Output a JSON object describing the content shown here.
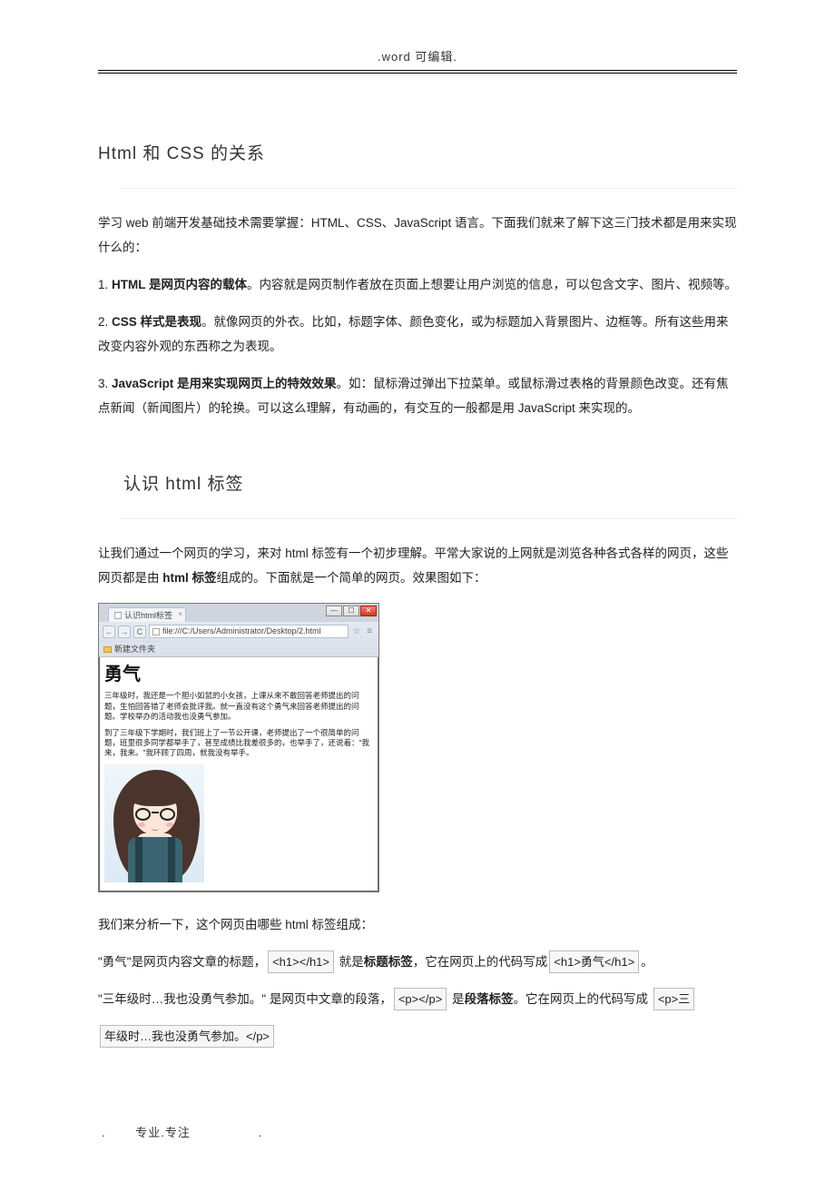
{
  "header": {
    "text": ".word 可编辑."
  },
  "footer": {
    "left_dot": ".",
    "center": "专业.专注",
    "right_dot": "."
  },
  "sections": {
    "s1": {
      "title": "Html 和 CSS 的关系",
      "p1_a": "学习 web 前端开发基础技术需要掌握：HTML、CSS、JavaScript 语言。下面我们就来了解下这三门技术都是用来实现什么的：",
      "li1_pre": "1. ",
      "li1_b": "HTML 是网页内容的载体",
      "li1_post": "。内容就是网页制作者放在页面上想要让用户浏览的信息，可以包含文字、图片、视频等。",
      "li2_pre": "2. ",
      "li2_b": "CSS 样式是表现",
      "li2_post": "。就像网页的外衣。比如，标题字体、颜色变化，或为标题加入背景图片、边框等。所有这些用来改变内容外观的东西称之为表现。",
      "li3_pre": "3. ",
      "li3_b": "JavaScript 是用来实现网页上的特效效果",
      "li3_post": "。如：鼠标滑过弹出下拉菜单。或鼠标滑过表格的背景颜色改变。还有焦点新闻（新闻图片）的轮换。可以这么理解，有动画的，有交互的一般都是用 JavaScript 来实现的。"
    },
    "s2": {
      "title": "认识 html 标签",
      "p1_a": "让我们通过一个网页的学习，来对 html 标签有一个初步理解。平常大家说的上网就是浏览各种各式各样的网页，这些网页都是由 ",
      "p1_b": "html 标签",
      "p1_c": "组成的。下面就是一个简单的网页。效果图如下：",
      "p2": "我们来分析一下，这个网页由哪些 html 标签组成：",
      "p3_a": "\"勇气\"是网页内容文章的标题，",
      "p3_tag": "<h1></h1>",
      "p3_b": " 就是",
      "p3_bold": "标题标签",
      "p3_c": "，它在网页上的代码写成",
      "p3_code": "<h1>勇气</h1>",
      "p3_d": "。",
      "p4_a": "\"三年级时…我也没勇气参加。\" 是网页中文章的段落，",
      "p4_tag": "<p></p>",
      "p4_b": " 是",
      "p4_bold": "段落标签",
      "p4_c": "。它在网页上的代码写成 ",
      "p4_code1": "<p>三",
      "p4_code2": "年级时…我也没勇气参加。</p>"
    }
  },
  "browser": {
    "tab_title": "认识html标签",
    "url": "file:///C:/Users/Administrator/Desktop/2.html",
    "bookmark": "新建文件夹",
    "page_title": "勇气",
    "para1": "三年级时，我还是一个胆小如鼠的小女孩，上课从来不敢回答老师提出的问题，生怕回答错了老师会批评我。就一直没有这个勇气来回答老师提出的问题。学校举办的活动我也没勇气参加。",
    "para2": "到了三年级下学期时，我们班上了一节公开课，老师提出了一个很简单的问题，班里很多同学都举手了，甚至成绩比我差很多的，也举手了，还说着：\"我来，我来。\"我环顾了四周，就我没有举手。"
  }
}
